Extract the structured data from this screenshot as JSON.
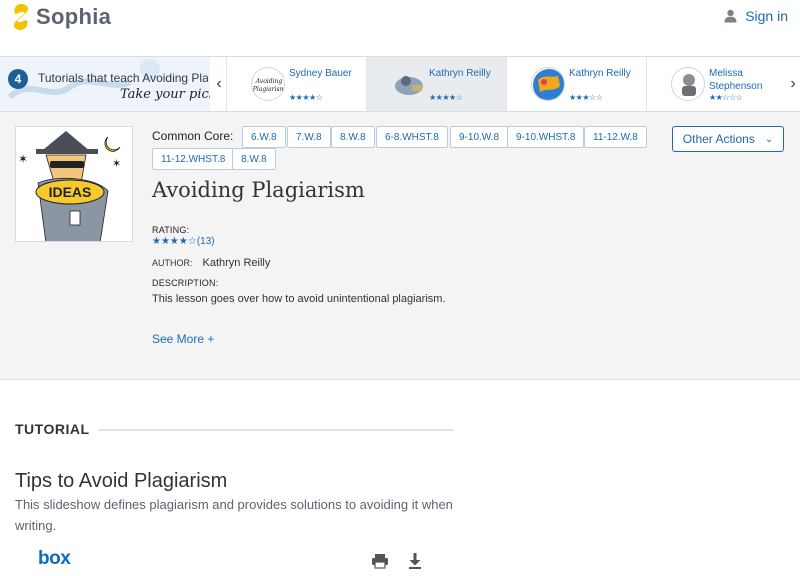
{
  "header": {
    "logo_text": "Sophia",
    "signin_label": "Sign in"
  },
  "carousel": {
    "count": "4",
    "intro_text": "Tutorials that teach Avoiding Plagiarism",
    "pick_text": "Take your pick:",
    "items": [
      {
        "name": "Sydney Bauer",
        "stars": "★★★★☆",
        "rating": 4
      },
      {
        "name": "Kathryn Reilly",
        "stars": "★★★★☆",
        "rating": 4
      },
      {
        "name": "Kathryn Reilly",
        "stars": "★★★☆☆",
        "rating": 3
      },
      {
        "name": "Melissa Stephenson",
        "stars": "★★☆☆☆",
        "rating": 2
      }
    ]
  },
  "detail": {
    "common_core_label": "Common Core:",
    "tags": [
      "6.W.8",
      "7.W.8",
      "8.W.8",
      "6-8.WHST.8",
      "9-10.W.8",
      "9-10.WHST.8",
      "11-12.W.8",
      "11-12.WHST.8",
      "8.W.8"
    ],
    "other_actions_label": "Other Actions",
    "title": "Avoiding Plagiarism",
    "rating_label": "RATING:",
    "rating_stars": "★★★★☆",
    "rating_count": "(13)",
    "author_label": "AUTHOR:",
    "author_name": "Kathryn Reilly",
    "description_label": "DESCRIPTION:",
    "description": "This lesson goes over how to avoid unintentional plagiarism.",
    "see_more_label": "See More +",
    "thumbnail_text": "IDEAS"
  },
  "tutorial": {
    "section_label": "TUTORIAL",
    "title": "Tips to Avoid Plagiarism",
    "description": "This slideshow defines plagiarism and provides solutions to avoiding it when writing.",
    "box_logo": "box"
  },
  "colors": {
    "accent": "#1a6bb3",
    "logo_yellow": "#f2c200",
    "panel_bg": "#f4f4f5"
  },
  "icons": [
    "sophia-logo-icon",
    "user-icon",
    "chevron-left-icon",
    "chevron-right-icon",
    "chevron-down-icon",
    "print-icon",
    "download-icon"
  ]
}
